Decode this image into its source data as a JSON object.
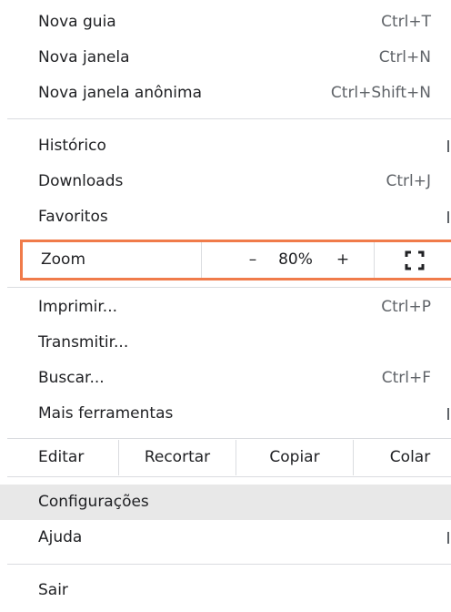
{
  "menu": {
    "new_tab": {
      "label": "Nova guia",
      "shortcut": "Ctrl+T"
    },
    "new_window": {
      "label": "Nova janela",
      "shortcut": "Ctrl+N"
    },
    "incognito": {
      "label": "Nova janela anônima",
      "shortcut": "Ctrl+Shift+N"
    },
    "history": {
      "label": "Histórico"
    },
    "downloads": {
      "label": "Downloads",
      "shortcut": "Ctrl+J"
    },
    "bookmarks": {
      "label": "Favoritos"
    },
    "zoom": {
      "label": "Zoom",
      "minus": "–",
      "value": "80%",
      "plus": "+"
    },
    "print": {
      "label": "Imprimir...",
      "shortcut": "Ctrl+P"
    },
    "cast": {
      "label": "Transmitir..."
    },
    "find": {
      "label": "Buscar...",
      "shortcut": "Ctrl+F"
    },
    "more_tools": {
      "label": "Mais ferramentas"
    },
    "edit": {
      "label": "Editar",
      "cut": "Recortar",
      "copy": "Copiar",
      "paste": "Colar"
    },
    "settings": {
      "label": "Configurações"
    },
    "help": {
      "label": "Ajuda"
    },
    "exit": {
      "label": "Sair"
    }
  },
  "colors": {
    "highlight_border": "#f07b4a",
    "hover_bg": "#e8e8e8"
  }
}
